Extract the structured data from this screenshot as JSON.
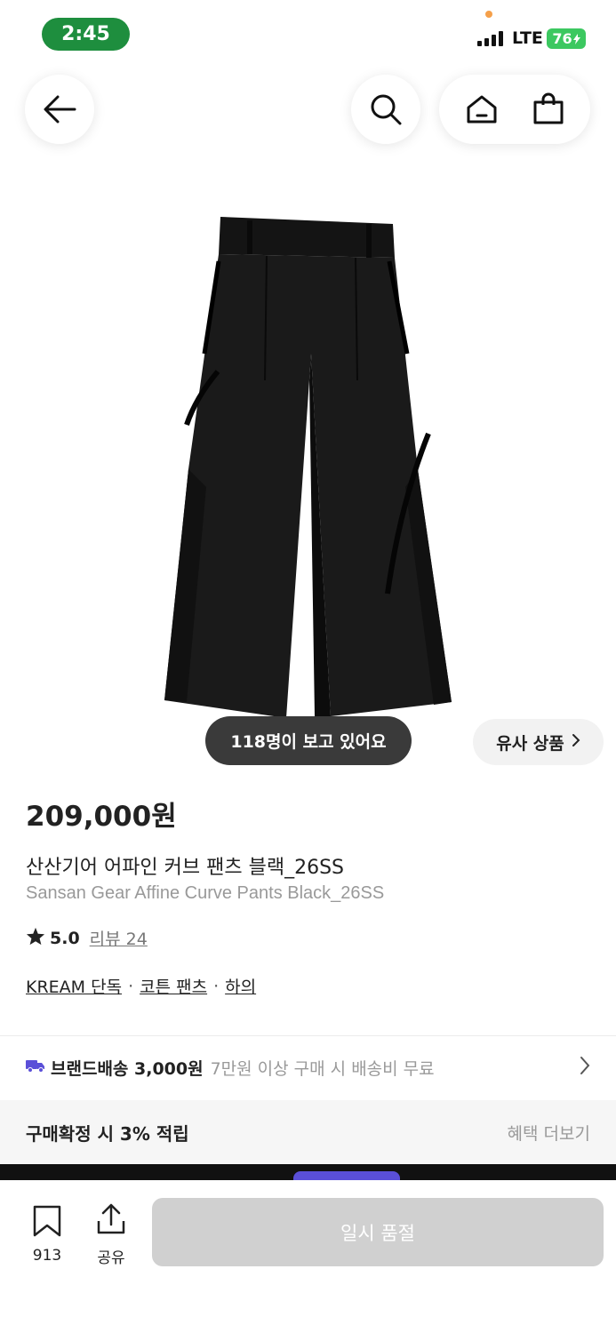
{
  "status_bar": {
    "time": "2:45",
    "network": "LTE",
    "battery": "76"
  },
  "nav": {
    "back_icon": "back-arrow-icon",
    "search_icon": "search-icon",
    "home_icon": "home-icon",
    "cart_icon": "shopping-bag-icon"
  },
  "product": {
    "image_icon": "black-pants-image",
    "viewers": "118명이 보고 있어요",
    "similar_label": "유사 상품",
    "price": "209,000원",
    "name_ko": "산산기어 어파인 커브 팬츠 블랙_26SS",
    "name_en": "Sansan Gear Affine Curve Pants Black_26SS",
    "rating": "5.0",
    "review_label": "리뷰 24",
    "tags": [
      "KREAM 단독",
      "코튼 팬츠",
      "하의"
    ],
    "tag_separator": "·"
  },
  "shipping": {
    "main": "브랜드배송 3,000원",
    "sub": "7만원 이상 구매 시 배송비 무료"
  },
  "points": {
    "label": "구매확정 시 3% 적립",
    "more": "혜택 더보기"
  },
  "bottom": {
    "bookmark_count": "913",
    "share_label": "공유",
    "buy_label": "일시 품절"
  },
  "colors": {
    "accent_green": "#1e8e3e",
    "battery_green": "#3cc860",
    "disabled_button": "#d0d0d0",
    "truck_purple": "#5a4fd8"
  }
}
